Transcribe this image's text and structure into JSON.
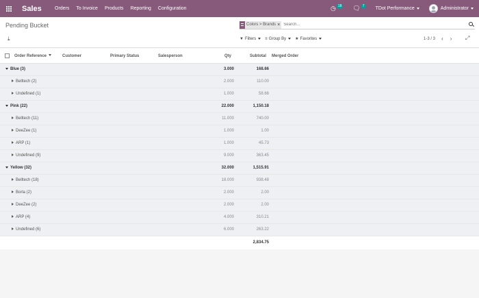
{
  "navbar": {
    "brand": "Sales",
    "menu": [
      "Orders",
      "To Invoice",
      "Products",
      "Reporting",
      "Configuration"
    ],
    "activities_count": "18",
    "messages_count": "7",
    "company": "TDot Performance",
    "user": "Administrator",
    "accent_color": "#875a7b"
  },
  "control": {
    "title": "Pending Bucket",
    "facet": "Colors > Brands",
    "search_placeholder": "Search...",
    "filters_label": "Filters",
    "groupby_label": "Group By",
    "favorites_label": "Favorites",
    "pager": "1-3 / 3"
  },
  "table": {
    "headers": {
      "order_reference": "Order Reference",
      "customer": "Customer",
      "primary_status": "Primary Status",
      "salesperson": "Salesperson",
      "qty": "Qty",
      "subtotal": "Subtotal",
      "merged_order": "Merged Order"
    },
    "rows": [
      {
        "level": 1,
        "name": "Blue (3)",
        "qty": "3.000",
        "subtotal": "168.66"
      },
      {
        "level": 2,
        "name": "Belltech (2)",
        "qty": "2.000",
        "subtotal": "110.00"
      },
      {
        "level": 2,
        "name": "Undefined (1)",
        "qty": "1.000",
        "subtotal": "58.66"
      },
      {
        "level": 1,
        "name": "Pink (22)",
        "qty": "22.000",
        "subtotal": "1,150.18"
      },
      {
        "level": 2,
        "name": "Belltech (11)",
        "qty": "11.000",
        "subtotal": "740.00"
      },
      {
        "level": 2,
        "name": "DeeZee (1)",
        "qty": "1.000",
        "subtotal": "1.00"
      },
      {
        "level": 2,
        "name": "ARP (1)",
        "qty": "1.000",
        "subtotal": "45.73"
      },
      {
        "level": 2,
        "name": "Undefined (9)",
        "qty": "9.000",
        "subtotal": "363.45"
      },
      {
        "level": 1,
        "name": "Yellow (32)",
        "qty": "32.000",
        "subtotal": "1,515.91"
      },
      {
        "level": 2,
        "name": "Belltech (18)",
        "qty": "18.000",
        "subtotal": "938.48"
      },
      {
        "level": 2,
        "name": "Borla (2)",
        "qty": "2.000",
        "subtotal": "2.00"
      },
      {
        "level": 2,
        "name": "DeeZee (2)",
        "qty": "2.000",
        "subtotal": "2.00"
      },
      {
        "level": 2,
        "name": "ARP (4)",
        "qty": "4.000",
        "subtotal": "310.21"
      },
      {
        "level": 2,
        "name": "Undefined (6)",
        "qty": "6.000",
        "subtotal": "263.22"
      }
    ],
    "total_subtotal": "2,834.75"
  }
}
